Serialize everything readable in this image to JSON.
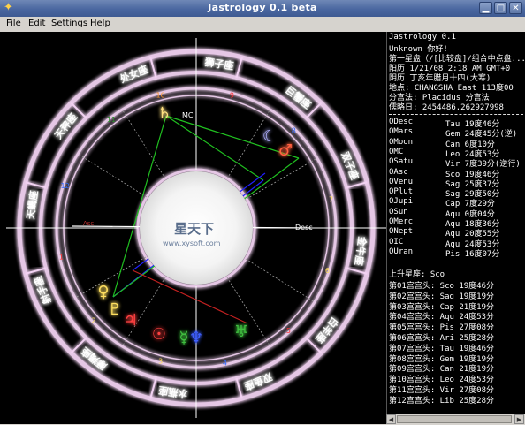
{
  "window": {
    "title": "Jastrology 0.1 beta"
  },
  "menu": [
    {
      "label": "File",
      "u": "F",
      "rest": "ile"
    },
    {
      "label": "Edit",
      "u": "E",
      "rest": "dit"
    },
    {
      "label": "Settings",
      "u": "S",
      "rest": "ettings"
    },
    {
      "label": "Help",
      "u": "H",
      "rest": "elp"
    }
  ],
  "chart": {
    "signs": [
      "狮子座",
      "巨蟹座",
      "双子座",
      "金牛座",
      "白羊座",
      "双鱼座",
      "水瓶座",
      "摩羯座",
      "射手座",
      "天蝎座",
      "天秤座",
      "处女座"
    ],
    "house_numbers": [
      "10",
      "9",
      "8",
      "7",
      "6",
      "5",
      "4",
      "3",
      "2",
      "1",
      "12",
      "11"
    ],
    "axis_labels": {
      "desc": "Desc",
      "mc": "MC",
      "asc": "Asc"
    },
    "watermark": {
      "name": "星天下",
      "url": "www.xysoft.com"
    }
  },
  "info": {
    "header": [
      "Jastrology 0.1",
      "Unknown 你好!",
      "第一星盘（/[比较盘]/组合中点盘...",
      "阳历 1/21/08 2:18 AM GMT+0",
      "阴历 丁亥年腊月十四(大寒)",
      "地点: CHANGSHA East 113度00",
      "分宫法: Placidus 分宫法",
      "儒略日: 2454486.262927998"
    ],
    "planets": [
      {
        "name": "ODesc",
        "value": "Tau 19度46分"
      },
      {
        "name": "OMars",
        "value": "Gem 24度45分(逆)"
      },
      {
        "name": "OMoon",
        "value": "Can 6度10分"
      },
      {
        "name": "OMC",
        "value": "Leo 24度53分"
      },
      {
        "name": "OSatu",
        "value": "Vir 7度39分(逆行)"
      },
      {
        "name": "OAsc",
        "value": "Sco 19度46分"
      },
      {
        "name": "OVenu",
        "value": "Sag 25度37分"
      },
      {
        "name": "OPlut",
        "value": "Sag 29度50分"
      },
      {
        "name": "OJupi",
        "value": "Cap 7度29分"
      },
      {
        "name": "OSun",
        "value": "Aqu 0度04分"
      },
      {
        "name": "OMerc",
        "value": "Aqu 18度36分"
      },
      {
        "name": "ONept",
        "value": "Aqu 20度55分"
      },
      {
        "name": "OIC",
        "value": "Aqu 24度53分"
      },
      {
        "name": "OUran",
        "value": "Pis 16度07分"
      }
    ],
    "ascendant_line": "上升星座: Sco",
    "houses": [
      "第01宫宫头: Sco 19度46分",
      "第02宫宫头: Sag 19度19分",
      "第03宫宫头: Cap 21度19分",
      "第04宫宫头: Aqu 24度53分",
      "第05宫宫头: Pis 27度08分",
      "第06宫宫头: Ari 25度28分",
      "第07宫宫头: Tau 19度46分",
      "第08宫宫头: Gem 19度19分",
      "第09宫宫头: Can 21度19分",
      "第10宫宫头: Leo 24度53分",
      "第11宫宫头: Vir 27度08分",
      "第12宫宫头: Lib 25度28分"
    ]
  },
  "colors": {
    "titlebar": "#4a67a0",
    "ring_glow": "#f0c8f0",
    "aspect_green": "#20c020",
    "aspect_blue": "#2020ff",
    "aspect_red": "#c02020"
  }
}
